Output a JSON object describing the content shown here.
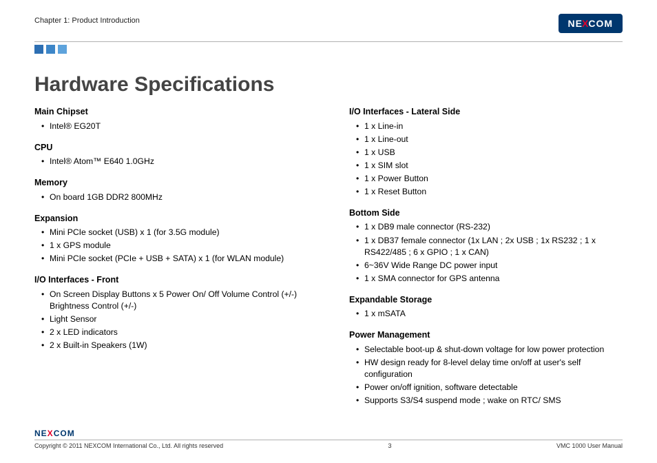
{
  "header": {
    "chapter": "Chapter 1: Product Introduction",
    "brand": "NE",
    "brand_x": "X",
    "brand2": "COM"
  },
  "title": "Hardware Specifications",
  "left": {
    "s1": {
      "h": "Main Chipset",
      "items": [
        "Intel® EG20T"
      ]
    },
    "s2": {
      "h": "CPU",
      "items": [
        "Intel® Atom™ E640 1.0GHz"
      ]
    },
    "s3": {
      "h": "Memory",
      "items": [
        "On board 1GB DDR2 800MHz"
      ]
    },
    "s4": {
      "h": "Expansion",
      "items": [
        "Mini PCIe socket (USB) x 1 (for 3.5G module)",
        "1 x GPS module",
        "Mini PCIe socket (PCIe + USB + SATA) x 1 (for WLAN module)"
      ]
    },
    "s5": {
      "h": "I/O Interfaces - Front",
      "items": [
        "On Screen Display Buttons x 5 Power On/ Off Volume Control (+/-) Brightness Control (+/-)",
        "Light Sensor",
        "2 x LED indicators",
        "2 x Built-in Speakers (1W)"
      ]
    }
  },
  "right": {
    "s1": {
      "h": "I/O Interfaces - Lateral Side",
      "items": [
        "1 x Line-in",
        "1 x Line-out",
        "1 x USB",
        "1 x SIM slot",
        "1 x Power Button",
        "1 x Reset Button"
      ]
    },
    "s2": {
      "h": "Bottom Side",
      "items": [
        "1 x DB9 male connector (RS-232)",
        "1 x DB37 female connector (1x LAN ; 2x USB ; 1x RS232 ; 1 x RS422/485 ; 6 x GPIO ; 1 x CAN)",
        "6~36V Wide Range DC power input",
        "1 x SMA connector for GPS antenna"
      ]
    },
    "s3": {
      "h": "Expandable Storage",
      "items": [
        "1 x mSATA"
      ]
    },
    "s4": {
      "h": "Power Management",
      "items": [
        "Selectable boot-up & shut-down voltage for low power protection",
        "HW design ready for 8-level delay time on/off at user's self configuration",
        "Power on/off ignition, software detectable",
        "Supports S3/S4 suspend mode ; wake on RTC/ SMS"
      ]
    }
  },
  "footer": {
    "copyright": "Copyright © 2011 NEXCOM International Co., Ltd. All rights reserved",
    "page": "3",
    "manual": "VMC 1000 User Manual"
  }
}
